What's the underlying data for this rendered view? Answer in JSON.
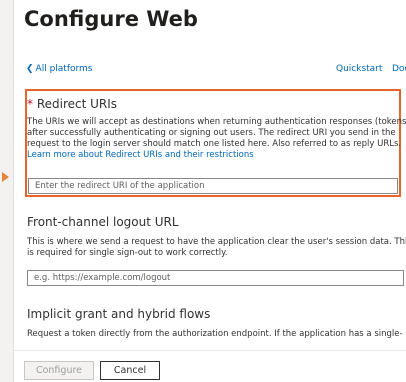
{
  "header": {
    "title": "Configure Web"
  },
  "nav": {
    "back_label": "All platforms",
    "back_chevron": "❮",
    "quickstart": "Quickstart",
    "docs": "Doc"
  },
  "redirect": {
    "required_mark": "*",
    "title": "Redirect URIs",
    "line1": "The URIs we will accept as destinations when returning authentication responses (tokens)",
    "line2": "after successfully authenticating or signing out users. The redirect URI you send in the",
    "line3": "request to the login server should match one listed here. Also referred to as reply URLs.",
    "link": "Learn more about Redirect URIs and their restrictions",
    "placeholder": "Enter the redirect URI of the application"
  },
  "logout": {
    "title": "Front-channel logout URL",
    "line1": "This is where we send a request to have the application clear the user's session data. This",
    "line2": "is required for single sign-out to work correctly.",
    "placeholder": "e.g. https://example.com/logout"
  },
  "implicit": {
    "title": "Implicit grant and hybrid flows",
    "line1": "Request a token directly from the authorization endpoint. If the application has a single-"
  },
  "footer": {
    "configure_label": "Configure",
    "cancel_label": "Cancel"
  },
  "colors": {
    "highlight": "#e8642a",
    "link": "#0067b8",
    "required": "#c50f1f"
  }
}
